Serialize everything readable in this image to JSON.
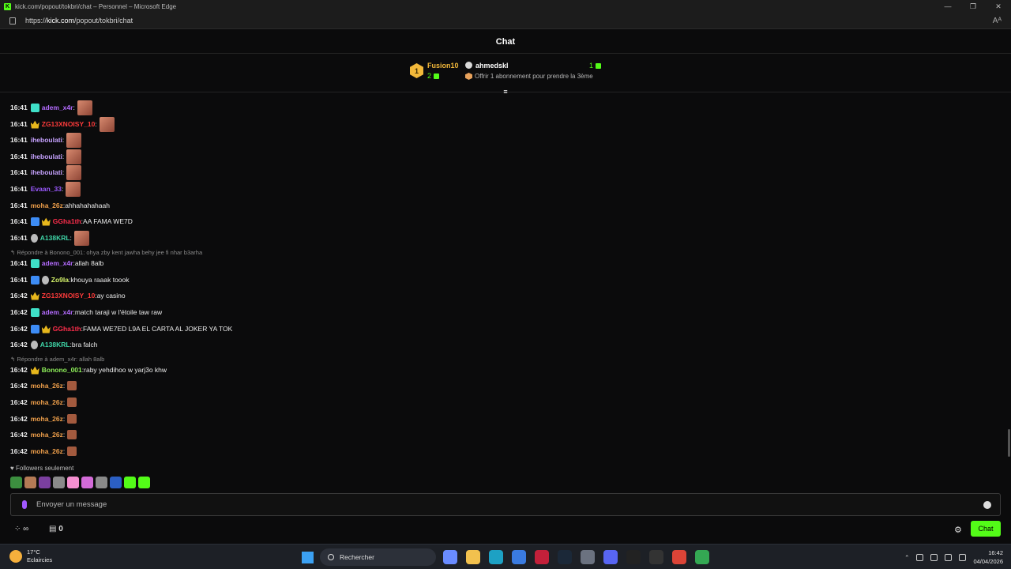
{
  "window": {
    "title": "kick.com/popout/tokbri/chat – Personnel – Microsoft Edge",
    "controls": [
      "—",
      "❐",
      "✕"
    ]
  },
  "address": {
    "prefix": "https://",
    "host": "kick.com",
    "path": "/popout/tokbri/chat",
    "read_aloud": "Aᴬ"
  },
  "chat": {
    "title": "Chat",
    "leaderboard": {
      "rank": "1",
      "top_name": "Fusion10",
      "top_count": "2",
      "second_name": "ahmedskl",
      "second_count": "1",
      "offer_text": "Offrir 1 abonnement pour prendre la 3ème"
    },
    "collapse_icon": "≡",
    "messages": [
      {
        "time": "16:41",
        "user": "adem_x4r",
        "color": "#b46cff",
        "badges": [
          "sub"
        ],
        "text": "",
        "emote": true
      },
      {
        "time": "16:41",
        "user": "ZG13XNOISY_10",
        "color": "#ff3b3b",
        "badges": [
          "crown"
        ],
        "text": "",
        "emote": true
      },
      {
        "time": "16:41",
        "user": "iheboulati",
        "color": "#c6a2ff",
        "badges": [],
        "text": "",
        "emote": true
      },
      {
        "time": "16:41",
        "user": "iheboulati",
        "color": "#c6a2ff",
        "badges": [],
        "text": "",
        "emote": true
      },
      {
        "time": "16:41",
        "user": "iheboulati",
        "color": "#c6a2ff",
        "badges": [],
        "text": "",
        "emote": true
      },
      {
        "time": "16:41",
        "user": "Evaan_33",
        "color": "#9b59ff",
        "badges": [],
        "text": "",
        "emote": true
      },
      {
        "time": "16:41",
        "user": "moha_26z",
        "color": "#f0a04b",
        "badges": [],
        "text": "ahhahahahaah",
        "emote": false
      },
      {
        "time": "16:41",
        "user": "GGha1th",
        "color": "#ff2e4c",
        "badges": [
          "verify",
          "crown"
        ],
        "text": "AA FAMA WE7D",
        "emote": false
      },
      {
        "time": "16:41",
        "user": "A138KRL",
        "color": "#3fd6a8",
        "badges": [
          "og"
        ],
        "text": "",
        "emote": true
      },
      {
        "time": "16:41",
        "user": "adem_x4r",
        "color": "#b46cff",
        "badges": [
          "sub"
        ],
        "text": "allah 8alb",
        "emote": false,
        "reply": "Répondre à Bonono_001: ohya zby kent jawha behy jee fi nhar b3arha"
      },
      {
        "time": "16:41",
        "user": "Zo9la",
        "color": "#d6f56b",
        "badges": [
          "verify",
          "og"
        ],
        "text": "khouya raaak toook",
        "emote": false
      },
      {
        "time": "16:42",
        "user": "ZG13XNOISY_10",
        "color": "#ff3b3b",
        "badges": [
          "crown"
        ],
        "text": "ay casino",
        "emote": false
      },
      {
        "time": "16:42",
        "user": "adem_x4r",
        "color": "#b46cff",
        "badges": [
          "sub"
        ],
        "text": "match taraji w l'étoile taw raw",
        "emote": false
      },
      {
        "time": "16:42",
        "user": "GGha1th",
        "color": "#ff2e4c",
        "badges": [
          "verify",
          "crown"
        ],
        "text": "FAMA WE7ED L9A EL CARTA AL JOKER YA TOK",
        "emote": false
      },
      {
        "time": "16:42",
        "user": "A138KRL",
        "color": "#3fd6a8",
        "badges": [
          "og"
        ],
        "text": "bra falch",
        "emote": false
      },
      {
        "time": "16:42",
        "user": "Bonono_001",
        "color": "#8ff05a",
        "badges": [
          "crown"
        ],
        "text": "raby yehdihoo w yarj3o khw",
        "emote": false,
        "reply": "Répondre à adem_x4r: allah 8alb"
      },
      {
        "time": "16:42",
        "user": "moha_26z",
        "color": "#f0a04b",
        "badges": [],
        "text": "",
        "emote": true,
        "small": true
      },
      {
        "time": "16:42",
        "user": "moha_26z",
        "color": "#f0a04b",
        "badges": [],
        "text": "",
        "emote": true,
        "small": true
      },
      {
        "time": "16:42",
        "user": "moha_26z",
        "color": "#f0a04b",
        "badges": [],
        "text": "",
        "emote": true,
        "small": true
      },
      {
        "time": "16:42",
        "user": "moha_26z",
        "color": "#f0a04b",
        "badges": [],
        "text": "",
        "emote": true,
        "small": true
      },
      {
        "time": "16:42",
        "user": "moha_26z",
        "color": "#f0a04b",
        "badges": [],
        "text": "",
        "emote": true,
        "small": true
      }
    ],
    "followers_only": "Followers seulement",
    "input_placeholder": "Envoyer un message",
    "points_icon": "∞",
    "store_count": "0",
    "send_label": "Chat"
  },
  "taskbar": {
    "temperature": "17°C",
    "weather": "Eclaircies",
    "search_label": "Rechercher",
    "time": "16:42",
    "date": "04/04/2026"
  }
}
